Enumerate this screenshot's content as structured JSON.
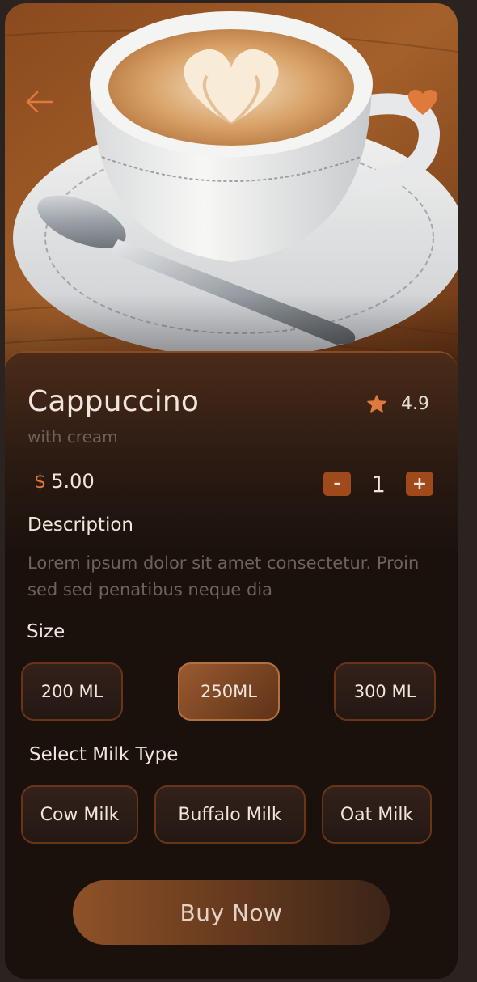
{
  "product": {
    "name": "Cappuccino",
    "subtitle": "with cream",
    "rating": "4.9",
    "currency_symbol": "$",
    "price": "5.00",
    "quantity": "1",
    "decrement_label": "-",
    "increment_label": "+"
  },
  "description": {
    "heading": "Description",
    "text": "Lorem ipsum dolor sit amet consectetur. Proin sed sed penatibus neque dia"
  },
  "size": {
    "heading": "Size",
    "options": [
      "200 ML",
      "250ML",
      "300 ML"
    ],
    "selected": "250ML"
  },
  "milk": {
    "heading": "Select Milk Type",
    "options": [
      "Cow Milk",
      "Buffalo Milk",
      "Oat Milk"
    ]
  },
  "actions": {
    "buy_label": "Buy Now"
  },
  "icons": {
    "back": "arrow-left-icon",
    "favorite": "heart-icon",
    "rating": "star-icon"
  },
  "colors": {
    "accent": "#e07a3c",
    "background": "#1a110d",
    "chip_border": "#6a3418",
    "muted_text": "#6e625b"
  }
}
